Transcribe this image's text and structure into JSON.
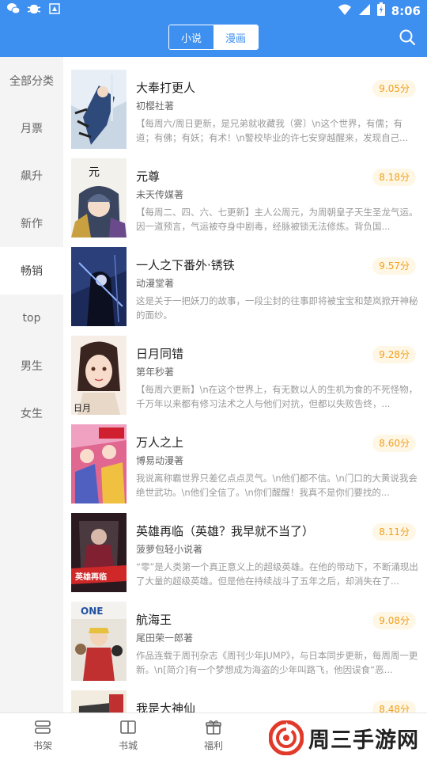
{
  "status_bar": {
    "time": "8:06",
    "left_icons": [
      "wechat-icon",
      "bug-icon",
      "notification-icon"
    ],
    "right_icons": [
      "wifi-icon",
      "signal-icon",
      "battery-icon"
    ]
  },
  "header": {
    "tabs": [
      {
        "label": "小说",
        "active": false
      },
      {
        "label": "漫画",
        "active": true
      }
    ],
    "search_icon": "search-icon"
  },
  "sidebar": {
    "items": [
      {
        "label": "全部分类",
        "active": false
      },
      {
        "label": "月票",
        "active": false
      },
      {
        "label": "飙升",
        "active": false
      },
      {
        "label": "新作",
        "active": false
      },
      {
        "label": "畅销",
        "active": true
      },
      {
        "label": "top",
        "active": false
      },
      {
        "label": "男生",
        "active": false
      },
      {
        "label": "女生",
        "active": false
      }
    ]
  },
  "books": [
    {
      "title": "大奉打更人",
      "author": "初樱社著",
      "score": "9.05分",
      "desc": "【每周六/周日更新，是兄弟就收藏我（雾〕\\n这个世界，有儒；有道；有佛；有妖；有术！\\n警校毕业的许七安穿越醒来，发现自己..."
    },
    {
      "title": "元尊",
      "author": "未天传媒著",
      "score": "8.18分",
      "desc": "【每周二、四、六、七更新】主人公周元，为周朝皇子天生圣龙气运。因一道预言，气运被夺身中剧毒，经脉被锁无法修炼。背负国..."
    },
    {
      "title": "一人之下番外·锈铁",
      "author": "动漫堂著",
      "score": "9.57分",
      "desc": "这是关于一把妖刀的故事，一段尘封的往事即将被宝宝和楚岚掀开神秘的面纱。"
    },
    {
      "title": "日月同错",
      "author": "第年秒著",
      "score": "9.28分",
      "desc": "【每周六更新】\\n在这个世界上，有无数以人的生机为食的不死怪物，千万年以来都有修习法术之人与他们对抗，但都以失败告终，..."
    },
    {
      "title": "万人之上",
      "author": "博易动漫著",
      "score": "8.60分",
      "desc": "我说离称霸世界只差亿点点灵气。\\n他们都不信。\\n门口的大黄说我会绝世武功。\\n他们全信了。\\n你们醒醒！我真不是你们要找的..."
    },
    {
      "title": "英雄再临（英雄？我早就不当了）",
      "author": "菠萝包轻小说著",
      "score": "8.11分",
      "desc": "“零”是人类第一个真正意义上的超级英雄。在他的带动下，不断涌现出了大量的超级英雄。但是他在持续战斗了五年之后，却消失在了..."
    },
    {
      "title": "航海王",
      "author": "尾田荣一郎著",
      "score": "9.08分",
      "desc": "作品连载于周刊杂志《周刊少年JUMP》，与日本同步更新，每周周一更新。\\n[简介]有一个梦想成为海盗的少年叫路飞，他因误食“恶..."
    },
    {
      "title": "我是大神仙",
      "author": "",
      "score": "8.48分",
      "desc": ""
    }
  ],
  "bottom_nav": {
    "items": [
      {
        "label": "书架",
        "icon": "bookshelf-icon"
      },
      {
        "label": "书城",
        "icon": "book-open-icon"
      },
      {
        "label": "福利",
        "icon": "gift-icon"
      }
    ]
  },
  "watermark": {
    "text": "周三手游网"
  },
  "colors": {
    "primary": "#3d8ff0",
    "score": "#f0a020",
    "score_bg": "#fff7e6",
    "sidebar_bg": "#f4f4f4"
  }
}
